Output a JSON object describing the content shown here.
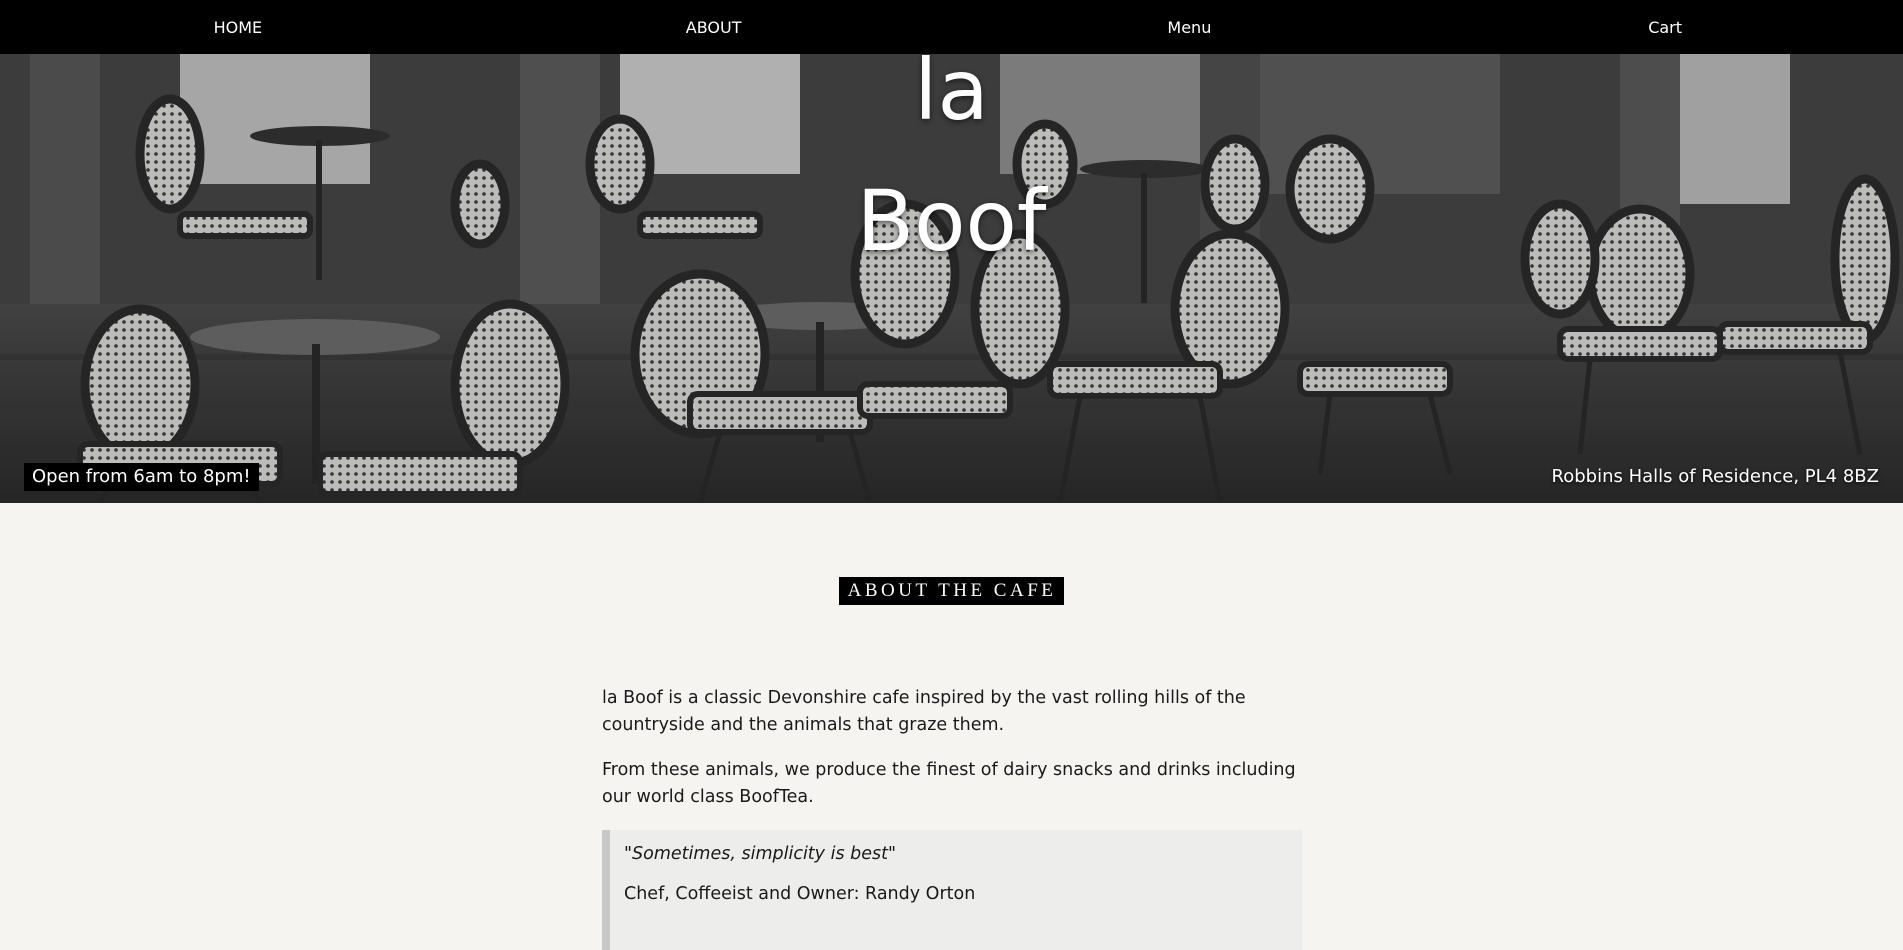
{
  "nav": {
    "items": [
      {
        "label": "HOME"
      },
      {
        "label": "ABOUT"
      },
      {
        "label": "Menu"
      },
      {
        "label": "Cart"
      }
    ]
  },
  "hero": {
    "title_line1": "la",
    "title_line2": "Boof",
    "hours": "Open from 6am to 8pm!",
    "address": "Robbins Halls of Residence, PL4 8BZ"
  },
  "about": {
    "heading": "ABOUT THE CAFE",
    "paragraphs": [
      "la Boof is a classic Devonshire cafe inspired by the vast rolling hills of the countryside and the animals that graze them.",
      "From these animals, we produce the finest of dairy snacks and drinks including our world class BoofTea."
    ],
    "quote": {
      "text": "\"Sometimes, simplicity is best\"",
      "attribution": "Chef, Coffeeist and Owner: Randy Orton"
    }
  },
  "colors": {
    "nav_bg": "#000000",
    "page_bg": "#f5f4f1",
    "heading_bg": "#000000",
    "quote_bg": "#ededec"
  }
}
